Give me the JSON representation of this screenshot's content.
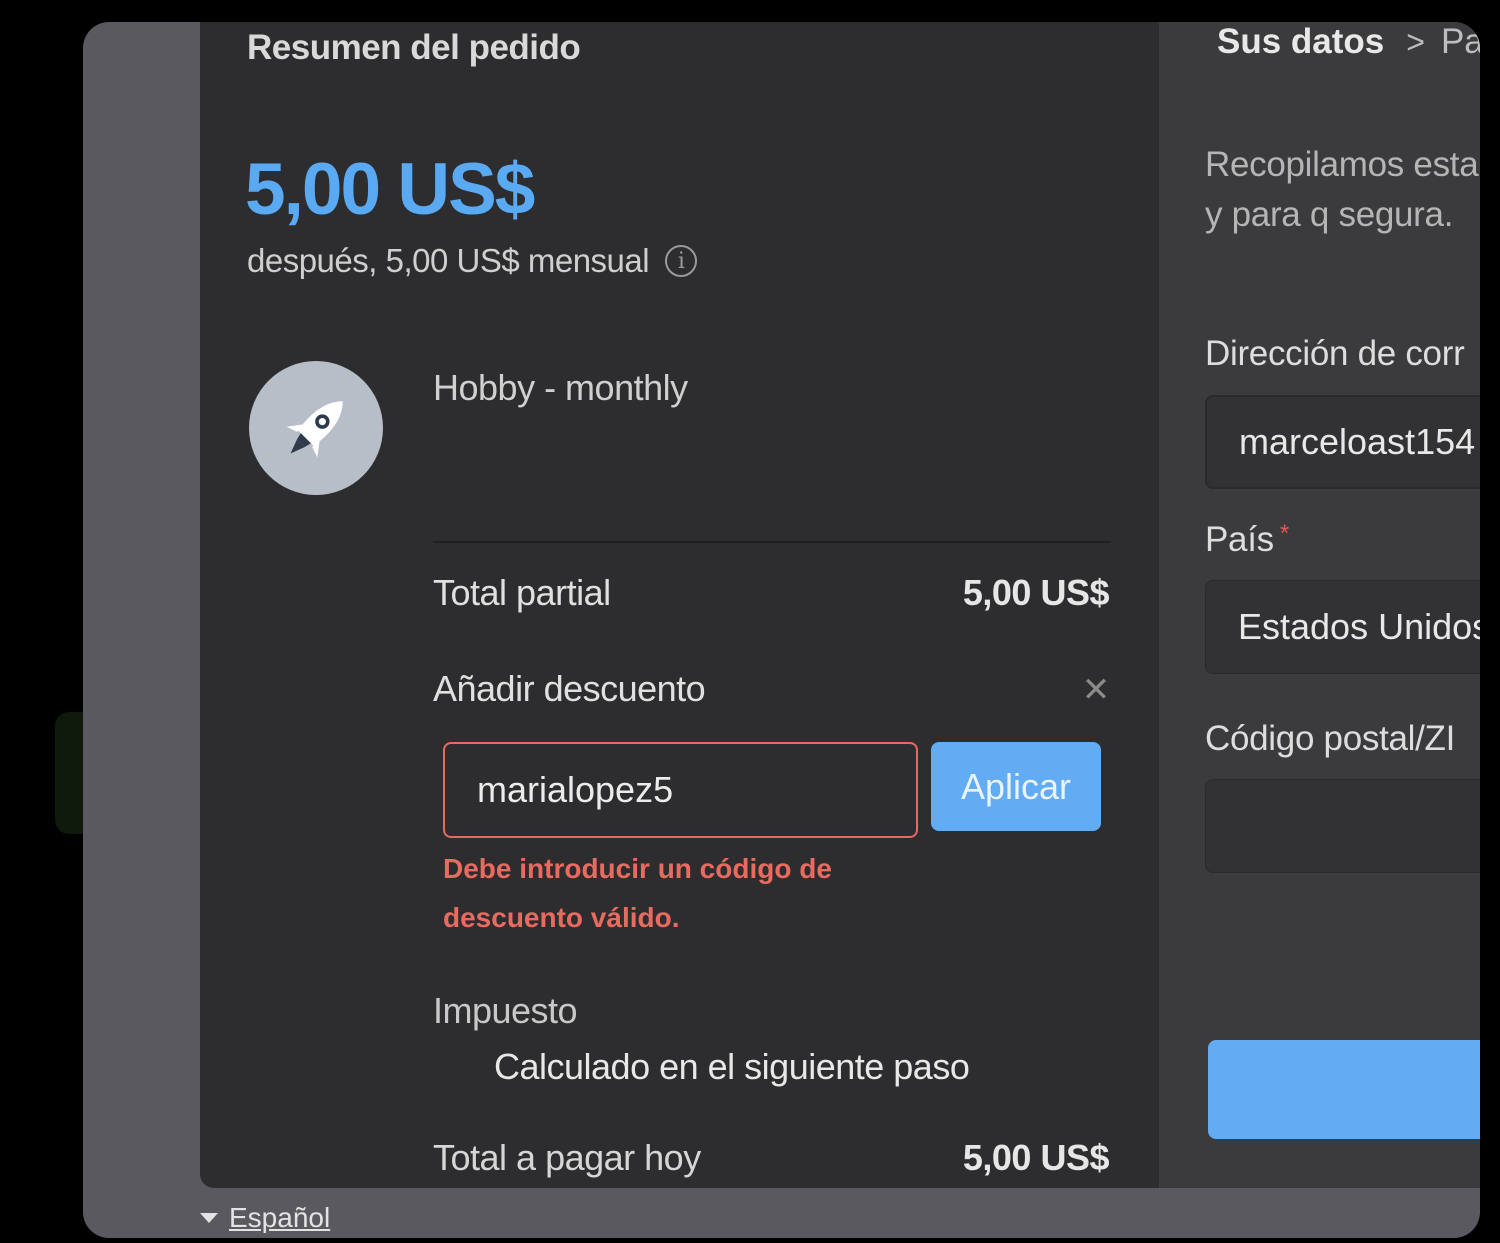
{
  "summary": {
    "title": "Resumen del pedido",
    "price": "5,00 US$",
    "price_sub": "después, 5,00 US$ mensual",
    "info_glyph": "i",
    "product_name": "Hobby - monthly",
    "subtotal_label": "Total partial",
    "subtotal_value": "5,00 US$",
    "discount_label": "Añadir descuento",
    "close_glyph": "✕",
    "discount_value": "marialopez5",
    "apply_label": "Aplicar",
    "discount_error": "Debe introducir un código de descuento válido.",
    "tax_label": "Impuesto",
    "tax_note": "Calculado en el siguiente paso",
    "total_label": "Total a pagar hoy",
    "total_value": "5,00 US$"
  },
  "footer": {
    "language": "Español"
  },
  "form": {
    "breadcrumb": {
      "current": "Sus datos",
      "separator": ">",
      "next": "Pa"
    },
    "intro": "Recopilamos esta el fraude y para q segura.",
    "email_label": "Dirección de corr",
    "email_value": "marceloast154",
    "country_label": "País",
    "required_mark": "*",
    "country_value": "Estados Unidos",
    "zip_label": "Código postal/ZI",
    "zip_value": ""
  },
  "colors": {
    "accent": "#5aa9f3",
    "button": "#62acf3",
    "error": "#e96a5f",
    "panel_dark": "#2d2d2f",
    "panel_form": "#3b3b3e"
  },
  "icons": {
    "product": "rocket-icon",
    "info": "info-icon",
    "close": "close-icon",
    "language": "caret-down-icon"
  }
}
